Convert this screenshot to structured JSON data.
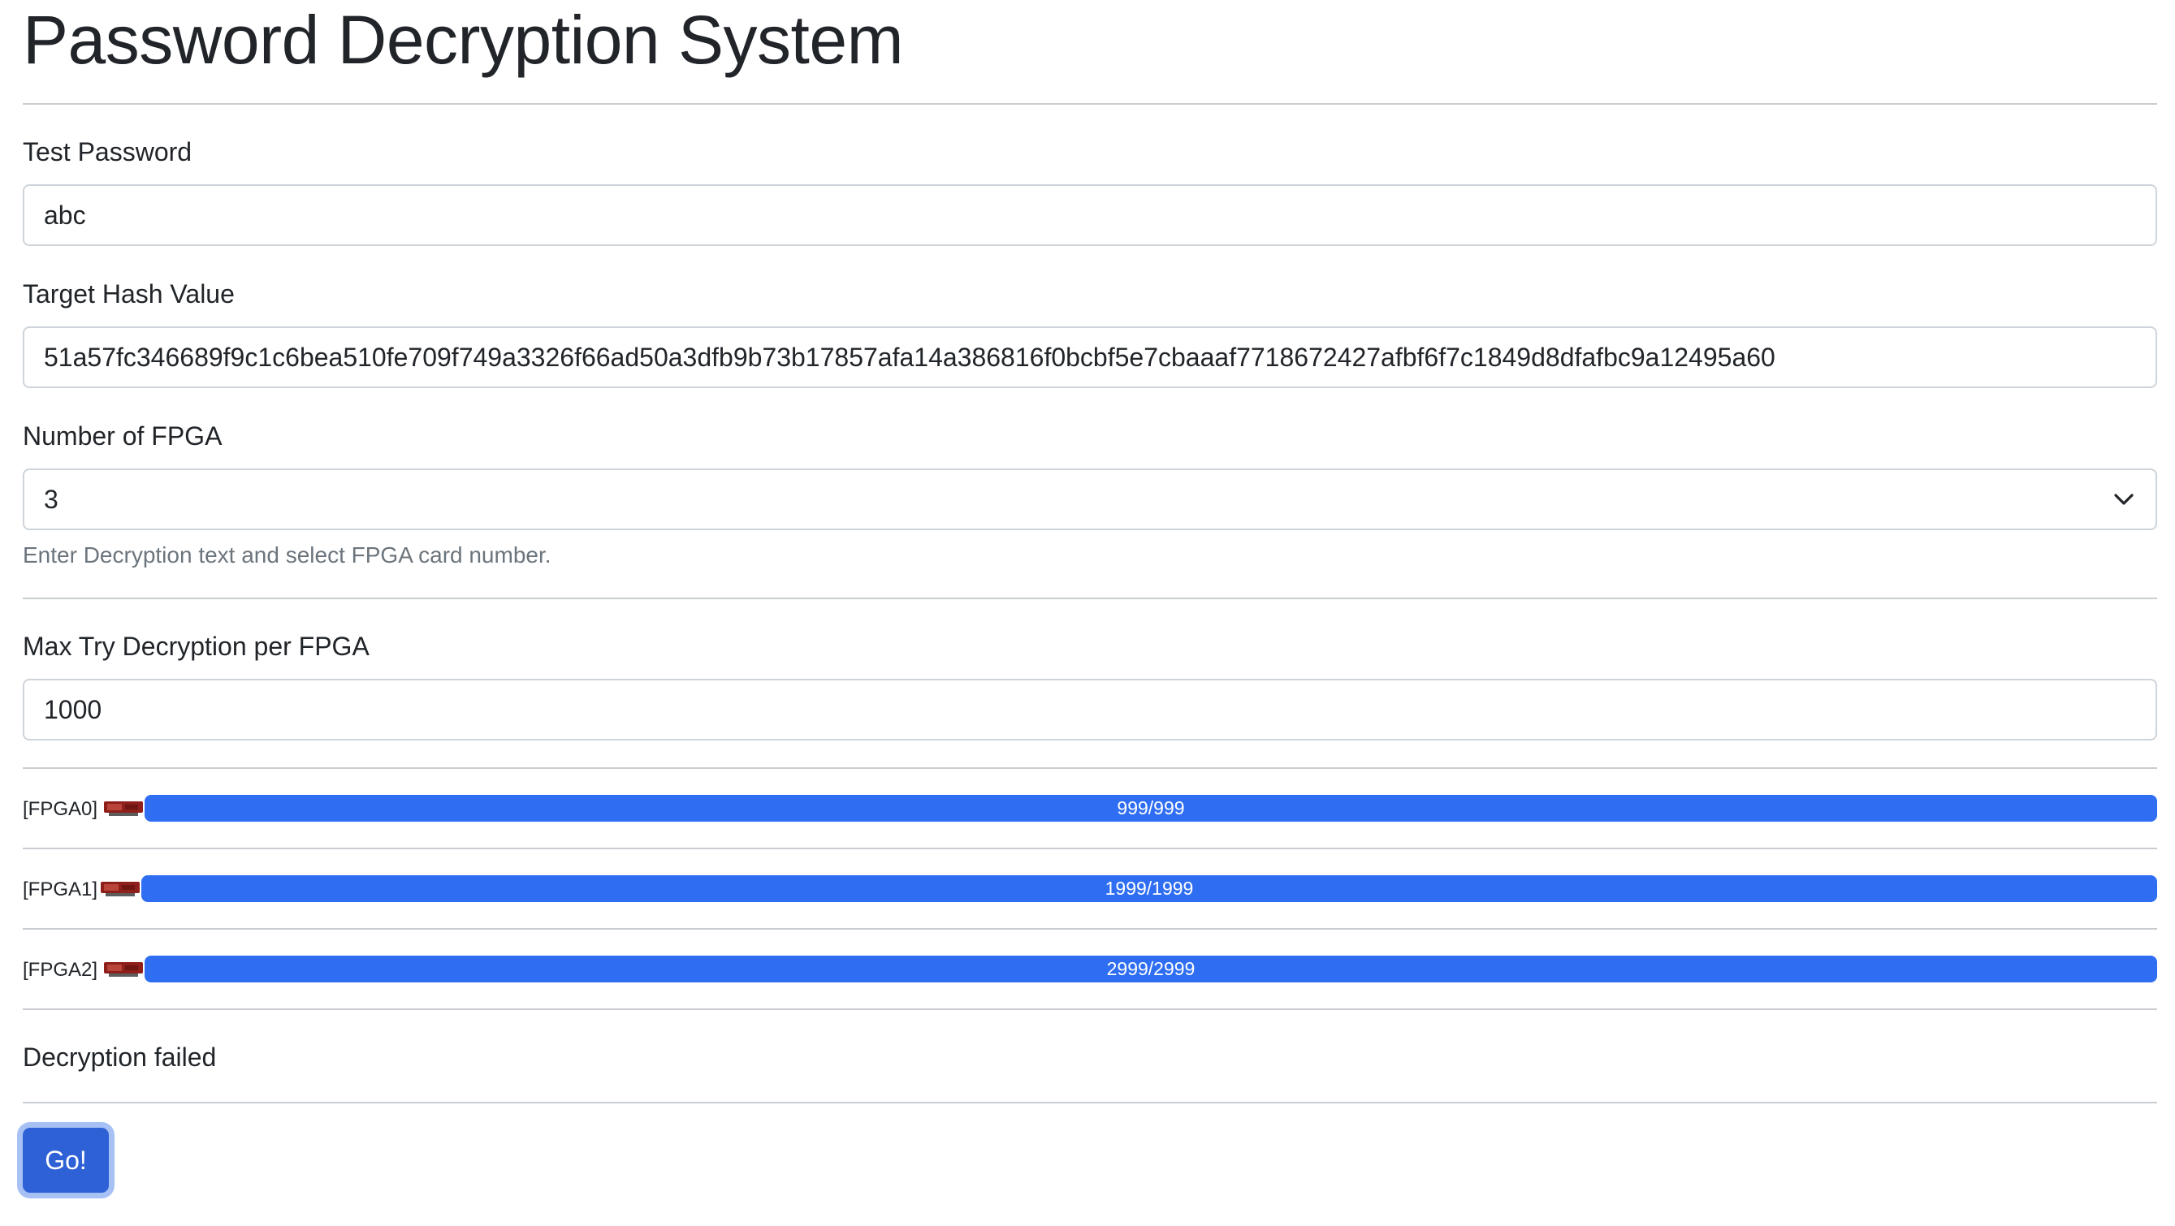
{
  "page": {
    "title": "Password Decryption System"
  },
  "form": {
    "test_password": {
      "label": "Test Password",
      "value": "abc"
    },
    "target_hash": {
      "label": "Target Hash Value",
      "value": "51a57fc346689f9c1c6bea510fe709f749a3326f66ad50a3dfb9b73b17857afa14a386816f0bcbf5e7cbaaaf7718672427afbf6f7c1849d8dfafbc9a12495a60"
    },
    "fpga_count": {
      "label": "Number of FPGA",
      "value": "3",
      "help": "Enter Decryption text and select FPGA card number."
    },
    "max_try": {
      "label": "Max Try Decryption per FPGA",
      "value": "1000"
    }
  },
  "fpgas": [
    {
      "label": "[FPGA0]",
      "progress_text": "999/999",
      "progress": 1.0,
      "icon": "fpga-card-icon"
    },
    {
      "label": "[FPGA1]",
      "progress_text": "1999/1999",
      "progress": 1.0,
      "icon": "fpga-card-icon"
    },
    {
      "label": "[FPGA2]",
      "progress_text": "2999/2999",
      "progress": 1.0,
      "icon": "fpga-card-icon"
    }
  ],
  "result": {
    "status": "Decryption failed"
  },
  "actions": {
    "go_label": "Go!"
  },
  "colors": {
    "accent": "#2f6ef2",
    "button": "#2e61d6",
    "help_text": "#6c757d"
  }
}
